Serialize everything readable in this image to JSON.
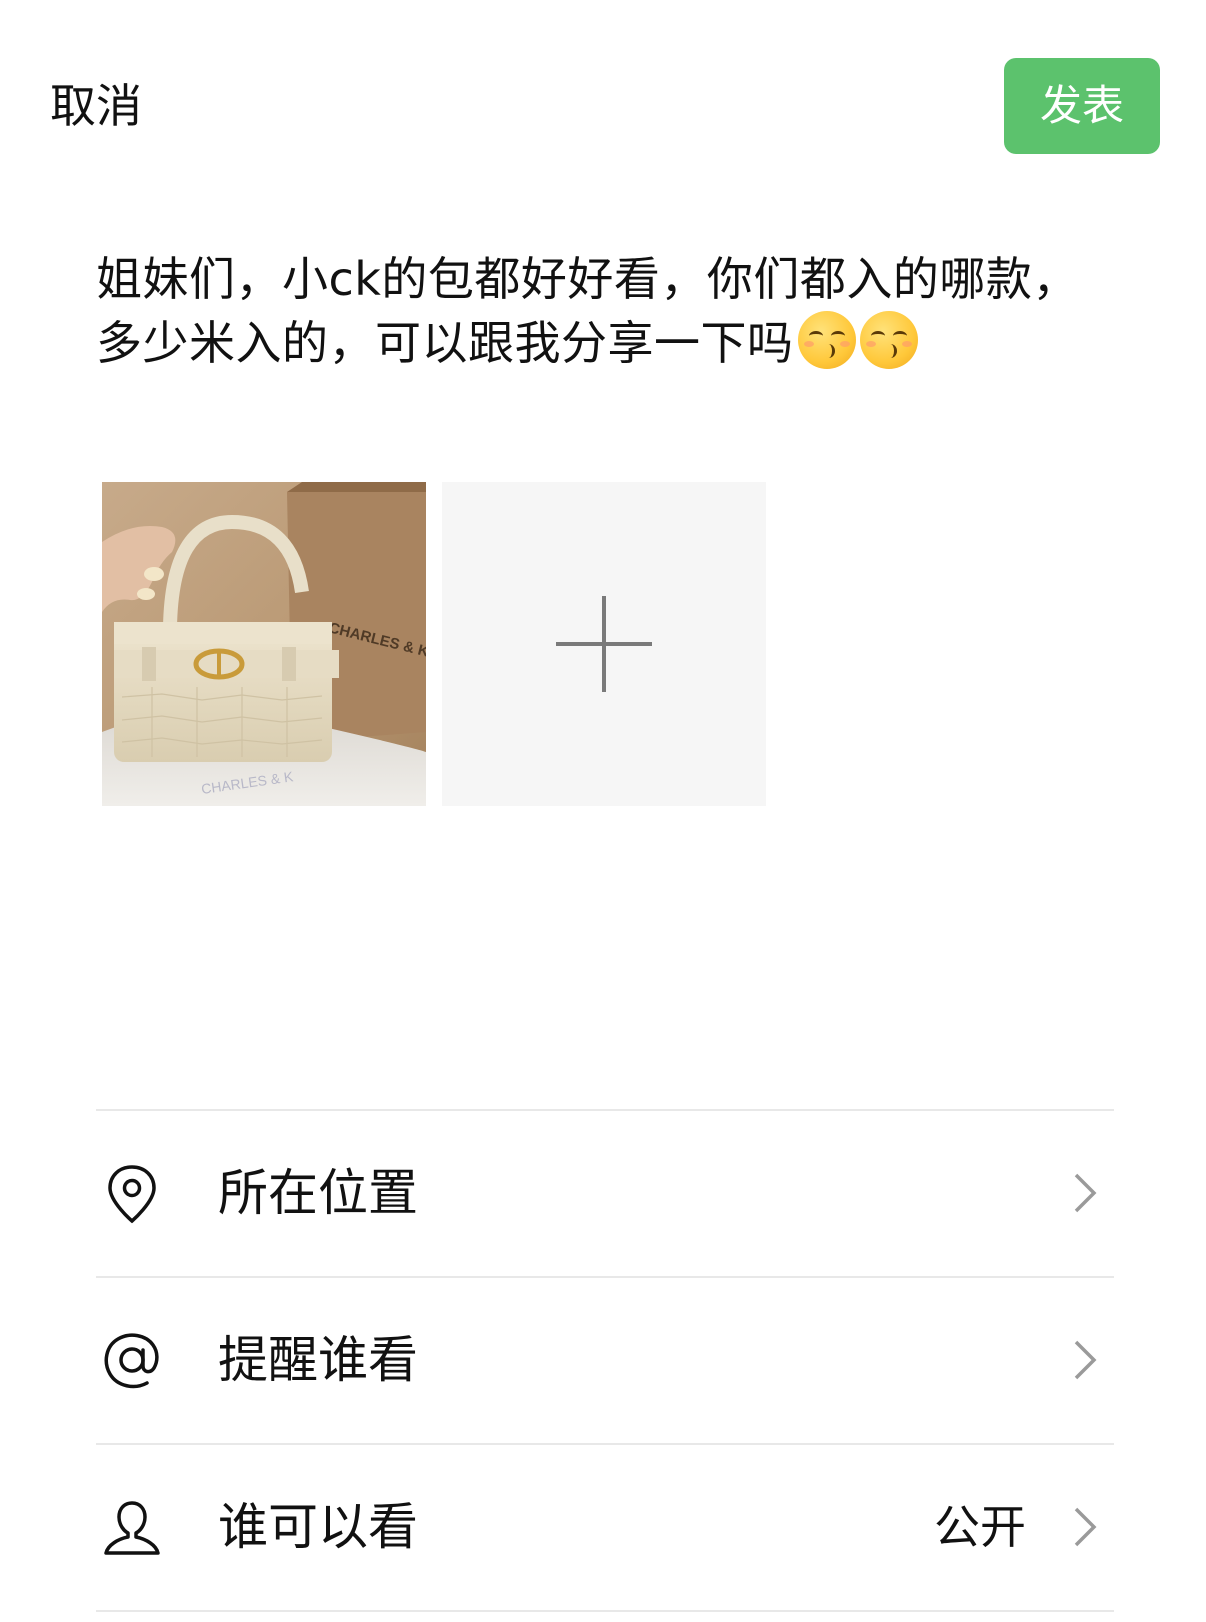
{
  "header": {
    "cancel_label": "取消",
    "publish_label": "发表",
    "publish_color": "#5cc26d"
  },
  "post": {
    "text": "姐妹们，小ck的包都好好看，你们都入的哪款，多少米入的，可以跟我分享一下吗",
    "emojis": [
      "kissing-face-emoji",
      "kissing-face-emoji"
    ]
  },
  "photos": {
    "items": [
      {
        "icon": "handbag-photo",
        "print_text": "CHARLES & K"
      }
    ],
    "add_icon": "plus-icon"
  },
  "options": [
    {
      "label": "所在位置",
      "icon": "location-pin-icon",
      "value": ""
    },
    {
      "label": "提醒谁看",
      "icon": "at-sign-icon",
      "value": ""
    },
    {
      "label": "谁可以看",
      "icon": "person-icon",
      "value": "公开"
    }
  ]
}
